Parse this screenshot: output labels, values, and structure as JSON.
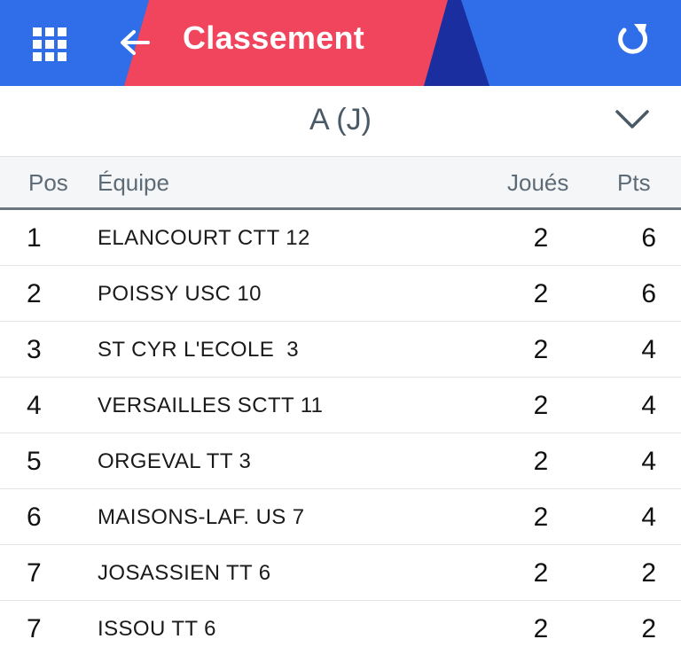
{
  "header": {
    "title": "Classement",
    "icons": {
      "menu": "grid-icon",
      "back": "arrow-left-icon",
      "refresh": "refresh-icon"
    },
    "colors": {
      "primary": "#2f6ee8",
      "accent_red": "#f0455c",
      "accent_navy": "#1a2ea0"
    }
  },
  "division": {
    "selected": "A (J)",
    "icon": "chevron-down-icon"
  },
  "table": {
    "columns": {
      "pos": "Pos",
      "team": "Équipe",
      "played": "Joués",
      "points": "Pts"
    },
    "rows": [
      {
        "pos": "1",
        "team": "ELANCOURT CTT 12",
        "played": "2",
        "points": "6"
      },
      {
        "pos": "2",
        "team": "POISSY USC 10",
        "played": "2",
        "points": "6"
      },
      {
        "pos": "3",
        "team": "ST CYR L'ECOLE  3",
        "played": "2",
        "points": "4"
      },
      {
        "pos": "4",
        "team": "VERSAILLES SCTT 11",
        "played": "2",
        "points": "4"
      },
      {
        "pos": "5",
        "team": "ORGEVAL TT 3",
        "played": "2",
        "points": "4"
      },
      {
        "pos": "6",
        "team": "MAISONS-LAF. US 7",
        "played": "2",
        "points": "4"
      },
      {
        "pos": "7",
        "team": "JOSASSIEN TT 6",
        "played": "2",
        "points": "2"
      },
      {
        "pos": "7",
        "team": "ISSOU TT 6",
        "played": "2",
        "points": "2"
      }
    ]
  }
}
